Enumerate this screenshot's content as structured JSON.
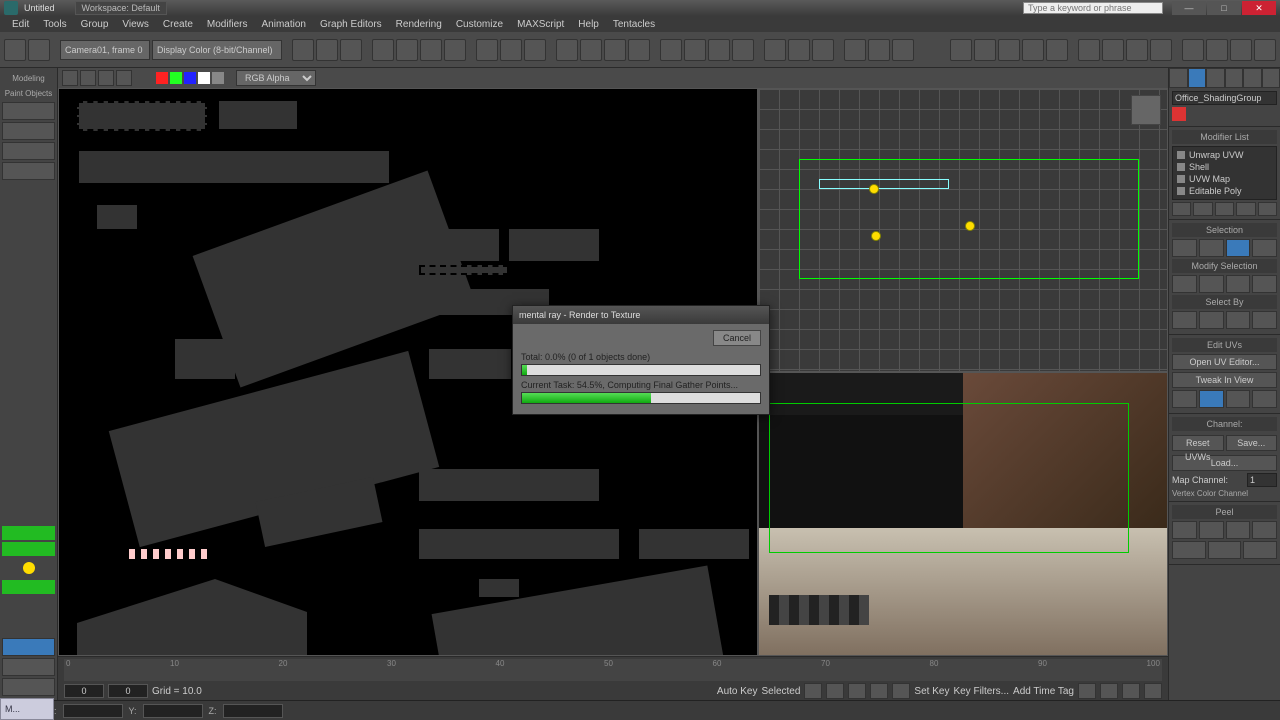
{
  "titlebar": {
    "filename": "Untitled",
    "workspace": "Workspace: Default",
    "search_placeholder": "Type a keyword or phrase"
  },
  "menu": [
    "Edit",
    "Tools",
    "Group",
    "Views",
    "Create",
    "Modifiers",
    "Animation",
    "Graph Editors",
    "Rendering",
    "Customize",
    "MAXScript",
    "Help",
    "Tentacles"
  ],
  "viewportbar": {
    "alpha_mode": "RGB Alpha",
    "camera": "Camera01, frame 0",
    "color_mode": "Display Color (8-bit/Channel)"
  },
  "dialog": {
    "title": "mental ray - Render to Texture",
    "cancel": "Cancel",
    "total_label": "Total:",
    "total_text": "0.0% (0 of 1 objects done)",
    "total_pct": 2,
    "task_label": "Current Task:",
    "task_text": "54.5%, Computing Final Gather Points...",
    "task_pct": 54
  },
  "rightpanel": {
    "object_name": "Office_ShadingGroup",
    "modifier_header": "Modifier List",
    "modifiers": [
      "Unwrap UVW",
      "Shell",
      "UVW Map",
      "Editable Poly"
    ],
    "selection_header": "Selection",
    "softsel_header": "Modify Selection",
    "selectby_header": "Select By",
    "edituvs_header": "Edit UVs",
    "open_editor": "Open UV Editor...",
    "tweak": "Tweak In View",
    "channel_header": "Channel:",
    "reset": "Reset UVWs",
    "save": "Save...",
    "load": "Load...",
    "mapchannel_label": "Map Channel:",
    "mapchannel_value": "1",
    "vertexcolor_label": "Vertex Color Channel",
    "peel_header": "Peel"
  },
  "timeline": {
    "ticks": [
      "0",
      "10",
      "20",
      "30",
      "40",
      "50",
      "60",
      "70",
      "80",
      "90",
      "100"
    ],
    "frame_a": "0",
    "frame_b": "0",
    "grid": "Grid = 10.0",
    "autokey": "Auto Key",
    "setkey": "Set Key",
    "keyfilters": "Key Filters...",
    "selected": "Selected",
    "addtimetag": "Add Time Tag"
  },
  "status": {
    "coords_x": "X:",
    "coords_y": "Y:",
    "coords_z": "Z:"
  },
  "taskfrag": "M..."
}
